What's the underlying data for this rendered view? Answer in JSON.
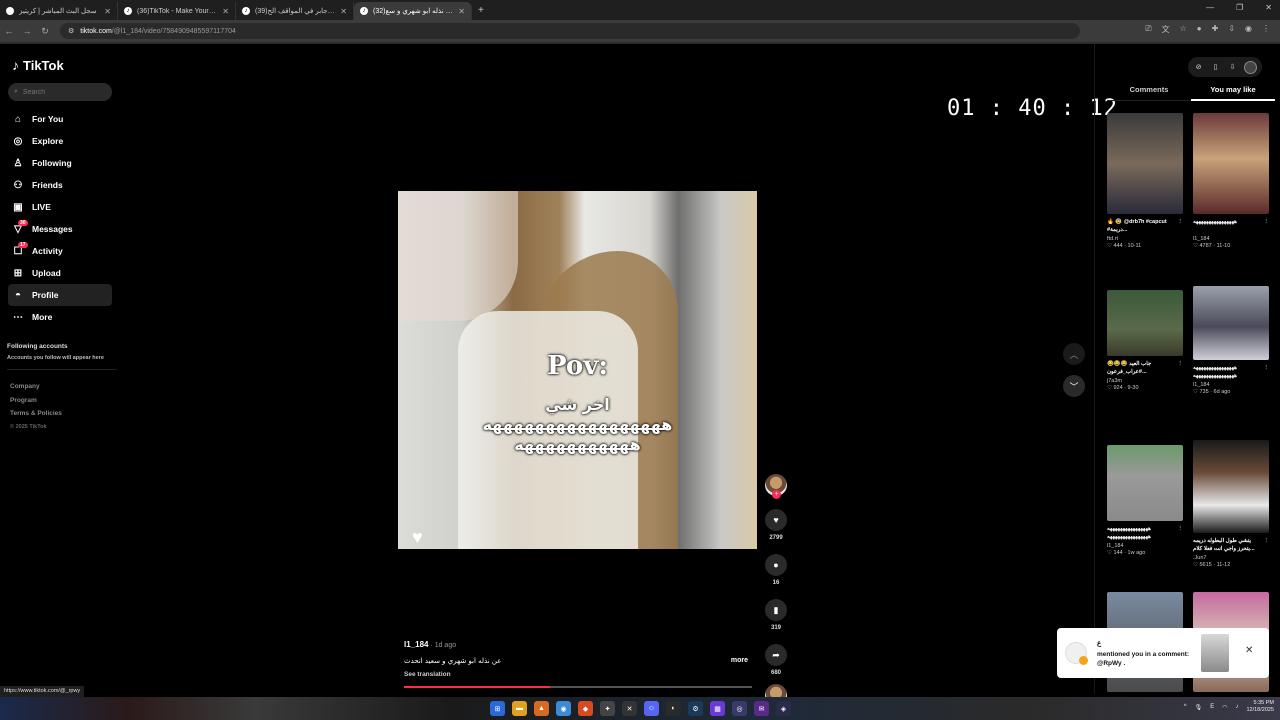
{
  "browser": {
    "tabs": [
      {
        "label": "سجل البث المباشر | كريتيز",
        "active": false
      },
      {
        "label": "(36)TikTok - Make Your Day",
        "active": false
      },
      {
        "label": "(39)عبدالله جابر في المواقف الح...",
        "active": false
      },
      {
        "label": "(32)عن نذله ابو شهري و سع...",
        "active": true
      }
    ],
    "url_host": "tiktok.com",
    "url_path": "/@l1_184/video/7584909485597117704"
  },
  "sidebar": {
    "logo": "TikTok",
    "search_placeholder": "Search",
    "items": [
      {
        "label": "For You",
        "icon": "home-icon"
      },
      {
        "label": "Explore",
        "icon": "compass-icon"
      },
      {
        "label": "Following",
        "icon": "following-icon"
      },
      {
        "label": "Friends",
        "icon": "friends-icon"
      },
      {
        "label": "LIVE",
        "icon": "live-icon"
      },
      {
        "label": "Messages",
        "icon": "messages-icon",
        "badge": "30"
      },
      {
        "label": "Activity",
        "icon": "activity-icon",
        "badge": "17"
      },
      {
        "label": "Upload",
        "icon": "upload-icon"
      },
      {
        "label": "Profile",
        "icon": "profile-icon"
      },
      {
        "label": "More",
        "icon": "more-icon"
      }
    ],
    "following_header": "Following accounts",
    "following_sub": "Accounts you follow will appear here",
    "footer_links": [
      "Company",
      "Program",
      "Terms & Policies"
    ],
    "copyright": "© 2025 TikTok"
  },
  "timer": "01 : 40 : 12",
  "video": {
    "overlay_title": "Pov:",
    "overlay_line1": "اخر شي",
    "overlay_line2": "هههههههههههههههههه",
    "overlay_line3": "هههههههههههه",
    "author": "l1_184",
    "posted": " · 1d ago",
    "description": "عن نذله ابو شهري و سعيد انحدث",
    "more_label": "more",
    "translation_label": "See translation",
    "progress": 0.42
  },
  "actions": {
    "likes": "2799",
    "comments": "16",
    "saves": "319",
    "shares": "680"
  },
  "right_panel": {
    "tabs": [
      "Comments",
      "You may like"
    ],
    "active_tab": 1,
    "cards": [
      {
        "title": "🔥 😨 @drb7h #capcut #دريمة...",
        "user": "ftd.rt",
        "likes": "444",
        "date": "10-11"
      },
      {
        "title": "ههههههههههههههههه",
        "user": "l1_184",
        "likes": "4787",
        "date": "11-10"
      },
      {
        "title": "😂😂😂 جاب العيد #عراب_فرعون...",
        "user": "j7a3m",
        "likes": "924",
        "date": "9-30"
      },
      {
        "title": "ههههههههههههههههه ههههههههههههههههه",
        "user": "l1_184",
        "likes": "735",
        "date": "6d ago"
      },
      {
        "title": "ههههههههههههههههه ههههههههههههههههه",
        "user": "l1_184",
        "likes": "144",
        "date": "1w ago"
      },
      {
        "title": "يتشي طول البطوله دريمه ...يتحرز واجي انت فعلا كلام",
        "user": ".Jun7",
        "likes": "5615",
        "date": "11-12"
      }
    ]
  },
  "notification": {
    "name": "ع",
    "text": "mentioned you in a comment: @RpWy ."
  },
  "status_link": "https://www.tiktok.com/@_rpwy",
  "clock": {
    "time": "5:35 PM",
    "date": "12/18/2025"
  }
}
